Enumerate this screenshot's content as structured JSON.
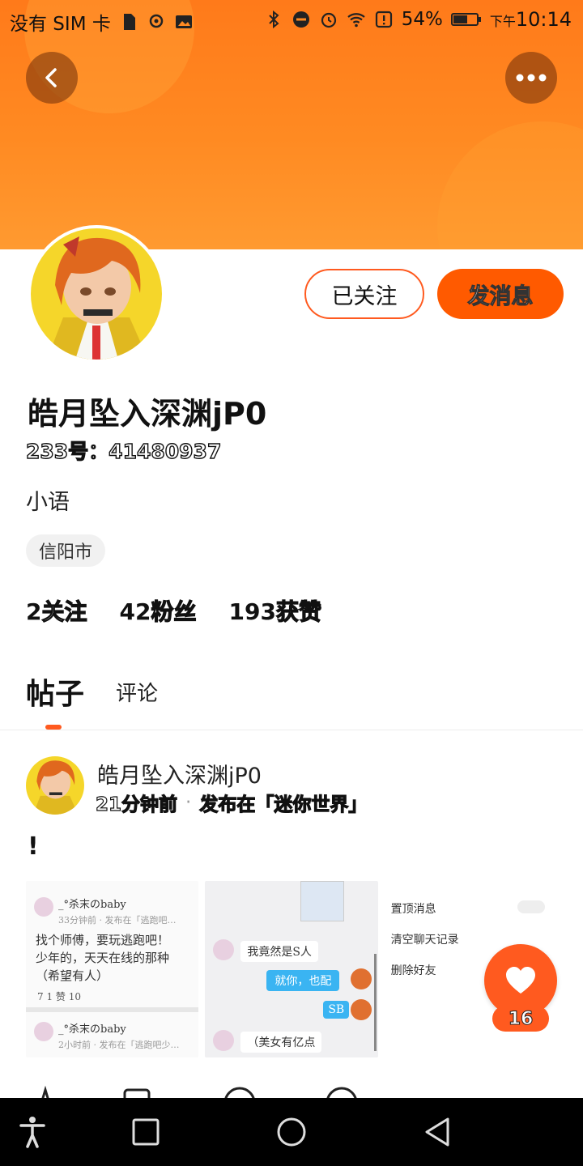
{
  "status_bar": {
    "carrier": "没有 SIM 卡",
    "battery": "54%",
    "time_prefix": "下午",
    "time": "10:14"
  },
  "profile": {
    "username": "皓月坠入深渊jP0",
    "id_label": "233号：41480937",
    "bio": "小语",
    "location": "信阳市",
    "followed_label": "已关注",
    "message_label": "发消息",
    "stats": [
      {
        "num": "2",
        "label": "关注"
      },
      {
        "num": "42",
        "label": "粉丝"
      },
      {
        "num": "193",
        "label": "获赞"
      }
    ]
  },
  "tabs": {
    "posts": "帖子",
    "comments": "评论"
  },
  "post": {
    "author": "皓月坠入深渊jP0",
    "time": "21分钟前",
    "published_in": "发布在「迷你世界」",
    "text": "!",
    "likes": "16"
  },
  "thumbnail1": {
    "name1": "_°杀末のbaby",
    "meta1": "33分钟前 · 发布在「逃跑吧…",
    "line1": "找个师傅，要玩逃跑吧！",
    "line2": "少年的，天天在线的那种",
    "line3": "（希望有人）",
    "counts": "7   1   赞   10",
    "name2": "_°杀末のbaby",
    "meta2": "2小时前 · 发布在「逃跑吧少…"
  },
  "thumbnail2": {
    "bubble1": "我竟然是S人",
    "bubble2": "就你，也配",
    "bubble3": "SB",
    "bubble4": "（美女有亿点"
  },
  "thumbnail3": {
    "item1": "置顶消息",
    "item2": "清空聊天记录",
    "item3": "删除好友"
  },
  "colors": {
    "accent": "#ff5a1f",
    "banner": "#ff8a22"
  }
}
